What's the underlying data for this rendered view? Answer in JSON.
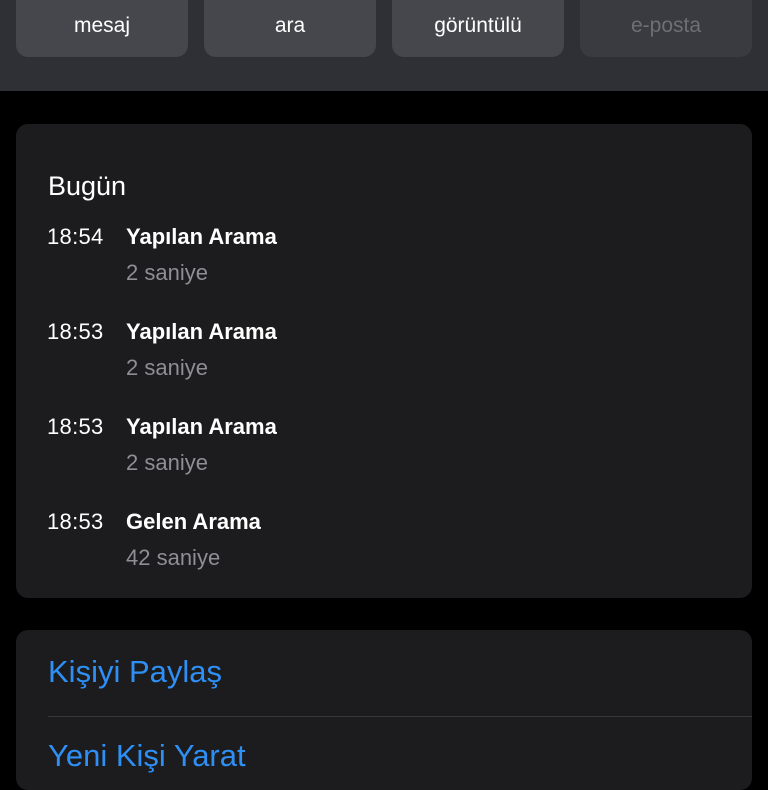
{
  "action_buttons": [
    {
      "label": "mesaj",
      "icon": "message-icon",
      "enabled": true
    },
    {
      "label": "ara",
      "icon": "phone-icon",
      "enabled": true
    },
    {
      "label": "görüntülü",
      "icon": "video-icon",
      "enabled": true
    },
    {
      "label": "e-posta",
      "icon": "mail-icon",
      "enabled": false
    }
  ],
  "call_history": {
    "section_title": "Bugün",
    "calls": [
      {
        "time": "18:54",
        "type": "Yapılan Arama",
        "duration": "2 saniye"
      },
      {
        "time": "18:53",
        "type": "Yapılan Arama",
        "duration": "2 saniye"
      },
      {
        "time": "18:53",
        "type": "Yapılan Arama",
        "duration": "2 saniye"
      },
      {
        "time": "18:53",
        "type": "Gelen Arama",
        "duration": "42 saniye"
      }
    ]
  },
  "contact_actions": {
    "share_contact": "Kişiyi Paylaş",
    "create_new_contact": "Yeni Kişi Yarat"
  },
  "colors": {
    "accent": "#2e8ff5",
    "card_background": "#1c1c1e",
    "header_background": "#2e3035",
    "button_background": "#45474d",
    "secondary_text": "#8e8e93"
  }
}
